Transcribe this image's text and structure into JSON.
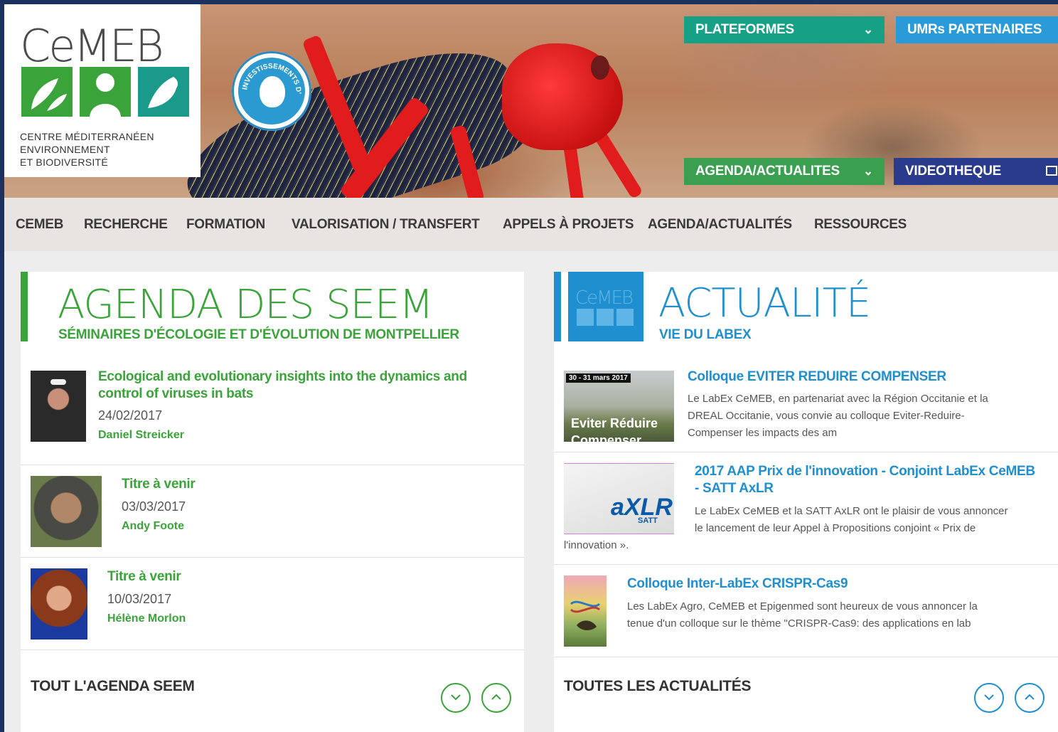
{
  "brand": {
    "logo_text": "CeMEB",
    "subtitle_lines": [
      "CENTRE MÉDITERRANÉEN",
      "ENVIRONNEMENT",
      "ET BIODIVERSITÉ"
    ],
    "seal_text": "INVESTISSEMENTS D'AVENIR"
  },
  "header_buttons": {
    "plateformes": "PLATEFORMES",
    "umrs": "UMRs PARTENAIRES",
    "agenda": "AGENDA/ACTUALITES",
    "videotheque": "VIDEOTHEQUE"
  },
  "nav": [
    "CEMEB",
    "RECHERCHE",
    "FORMATION",
    "VALORISATION / TRANSFERT",
    "APPELS À PROJETS",
    "AGENDA/ACTUALITÉS",
    "RESSOURCES"
  ],
  "agenda": {
    "title": "AGENDA DES SEEM",
    "subtitle": "SÉMINAIRES D'ÉCOLOGIE ET D'ÉVOLUTION DE MONTPELLIER",
    "items": [
      {
        "title_line1": "Ecological and evolutionary insights into the dynamics and",
        "title_line2": "control of viruses in bats",
        "date": "24/02/2017",
        "speaker": "Daniel Streicker"
      },
      {
        "title_line1": "Titre à venir",
        "date": "03/03/2017",
        "speaker": "Andy Foote"
      },
      {
        "title_line1": "Titre à venir",
        "date": "10/03/2017",
        "speaker": "Hélène Morlon"
      }
    ],
    "footer": "TOUT L'AGENDA SEEM"
  },
  "news": {
    "title": "ACTUALITÉ",
    "subtitle": "VIE DU LABEX",
    "items": [
      {
        "title": "Colloque EVITER REDUIRE COMPENSER",
        "thumb_date": "30 - 31 mars 2017",
        "thumb_caption": "Eviter Réduire",
        "thumb_caption2": "Compenser",
        "text_lines": [
          "Le LabEx CeMEB, en partenariat avec la Région Occitanie et la",
          "DREAL Occitanie, vous convie au colloque Eviter-Reduire-",
          "Compenser les impacts des am"
        ]
      },
      {
        "title_line1": "2017 AAP Prix de l'innovation - Conjoint LabEx CeMEB",
        "title_line2": "- SATT AxLR",
        "thumb_text": "aXLR",
        "thumb_sub": "SATT",
        "text_lines": [
          "Le LabEx CeMEB et la SATT AxLR ont le plaisir de vous annoncer",
          "le lancement de leur Appel à Propositions conjoint « Prix de",
          "l'innovation »."
        ]
      },
      {
        "title": "Colloque Inter-LabEx CRISPR-Cas9",
        "text_lines": [
          "Les LabEx Agro, CeMEB et Epigenmed sont heureux de vous annoncer la",
          "tenue d'un colloque sur le thème \"CRISPR-Cas9: des applications en lab"
        ]
      }
    ],
    "footer": "TOUTES LES ACTUALITÉS"
  },
  "colors": {
    "green": "#3aa43a",
    "blue": "#1f8fcf",
    "teal_button": "#16a085",
    "sky_button": "#2a9ad8",
    "navy_button": "#2a3a8c",
    "green_button": "#3aa050"
  }
}
